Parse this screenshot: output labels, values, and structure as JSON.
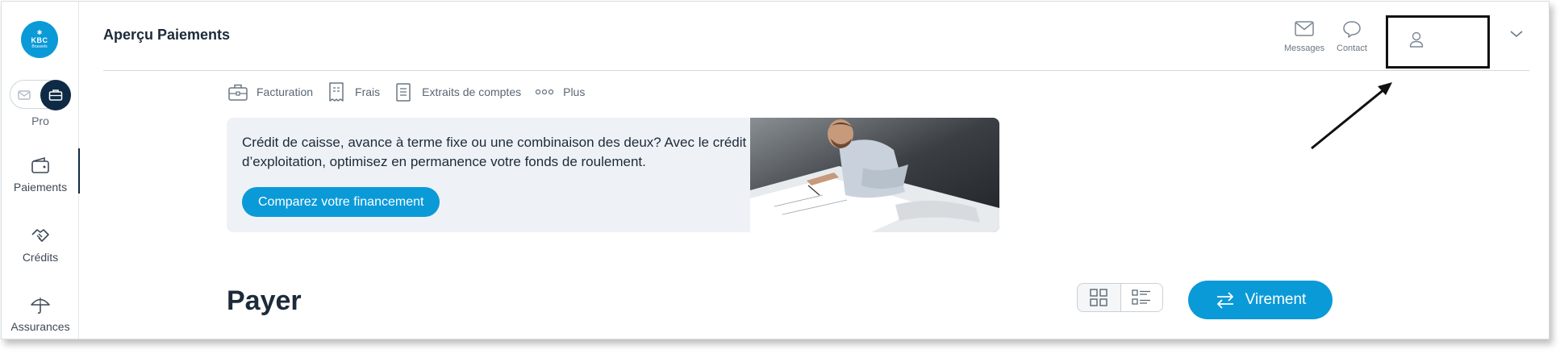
{
  "brand": {
    "logo_top": "✱",
    "logo_main": "KBC",
    "logo_sub": "Brussels"
  },
  "rail": {
    "toggle_label": "Pro",
    "items": [
      {
        "label": "Paiements",
        "icon": "wallet-icon",
        "active": true
      },
      {
        "label": "Crédits",
        "icon": "handshake-icon"
      },
      {
        "label": "Assurances",
        "icon": "umbrella-icon"
      }
    ]
  },
  "header": {
    "title": "Aperçu Paiements",
    "messages_label": "Messages",
    "contact_label": "Contact"
  },
  "sublinks": [
    {
      "label": "Facturation",
      "icon": "briefcase-icon"
    },
    {
      "label": "Frais",
      "icon": "receipt-icon"
    },
    {
      "label": "Extraits de comptes",
      "icon": "document-icon"
    },
    {
      "label": "Plus",
      "icon": "more-dots-icon"
    }
  ],
  "promo": {
    "text": "Crédit de caisse, avance à terme fixe ou une combinaison des deux? Avec le crédit d’exploitation, optimisez en permanence votre fonds de roulement.",
    "button_label": "Comparez votre financement"
  },
  "pay": {
    "title": "Payer",
    "transfer_label": "Virement"
  },
  "colors": {
    "accent": "#0a9ad8",
    "navy": "#0f2a44",
    "promo_bg": "#eef2f6"
  }
}
